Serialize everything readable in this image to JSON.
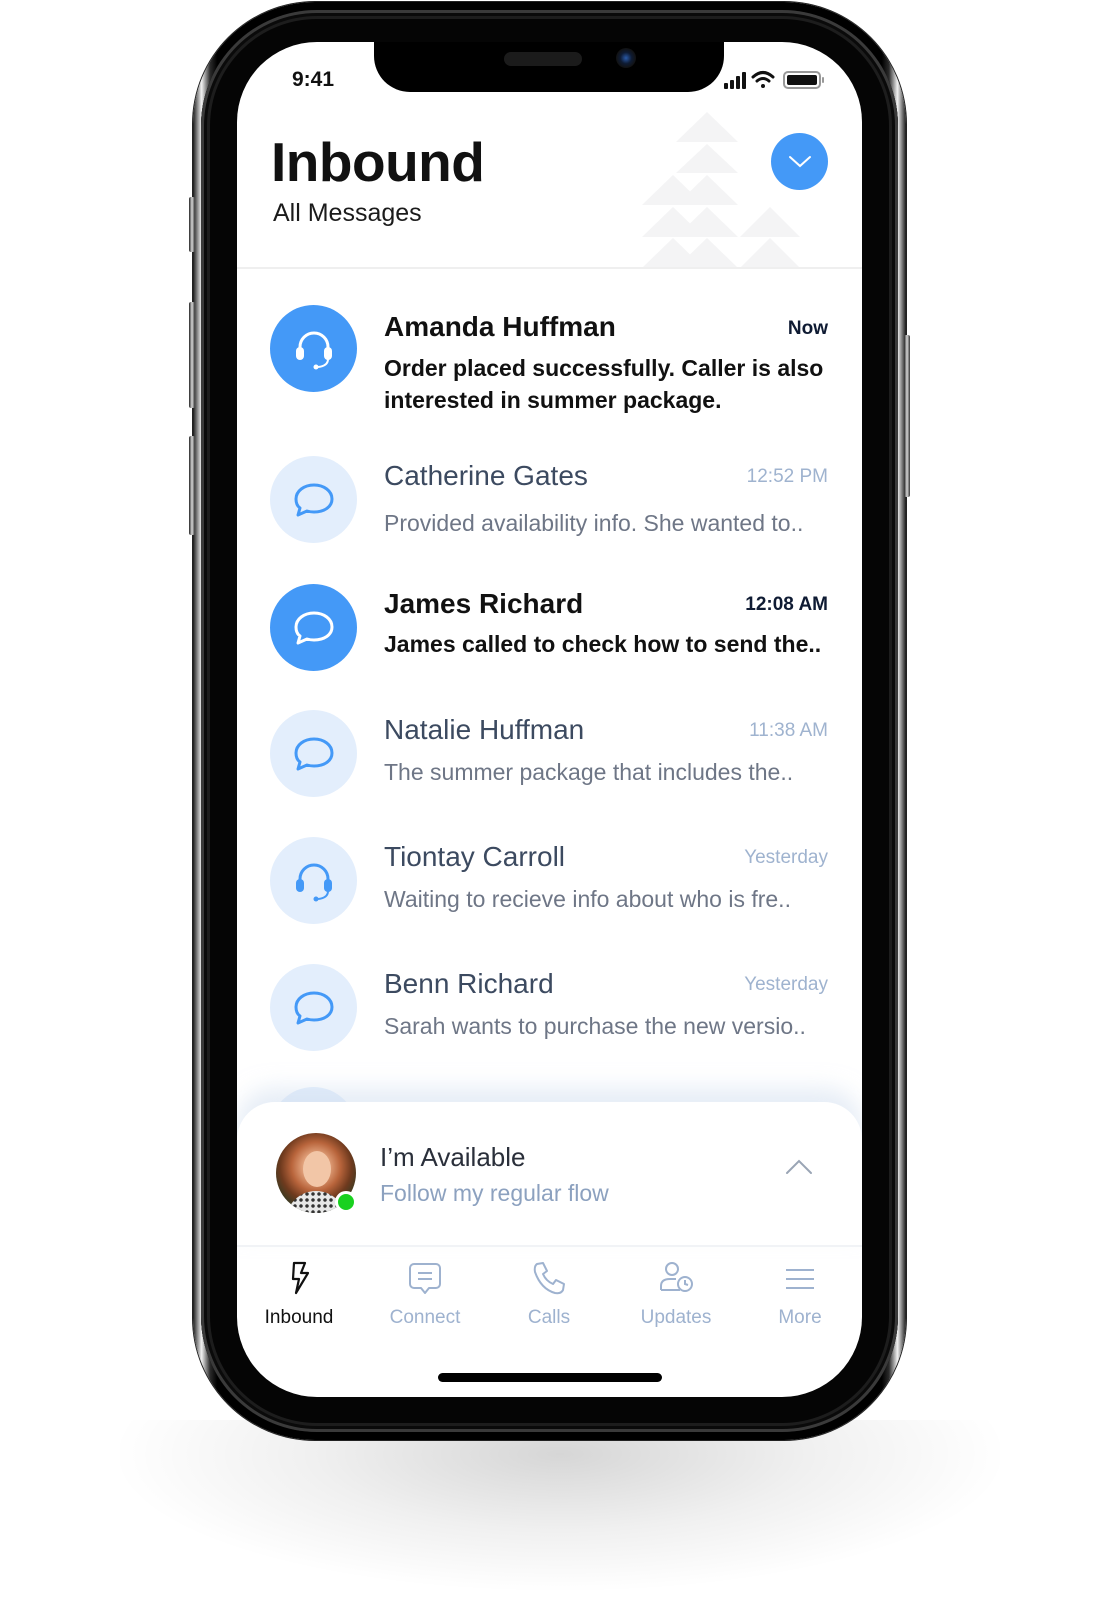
{
  "status_bar": {
    "time": "9:41",
    "icons": [
      "cellular-signal-icon",
      "wifi-icon",
      "battery-icon"
    ]
  },
  "header": {
    "title": "Inbound",
    "subtitle": "All Messages",
    "filter_button_icon": "chevron-down-icon",
    "accent_color": "#4499f7"
  },
  "messages": [
    {
      "name": "Amanda Huffman",
      "time": "Now",
      "preview": "Order placed successfully. Caller is also interested in summer package.",
      "icon": "headset-icon",
      "unread": true
    },
    {
      "name": "Catherine Gates",
      "time": "12:52 PM",
      "preview": "Provided availability info. She wanted to..",
      "icon": "chat-bubble-icon",
      "unread": false
    },
    {
      "name": "James Richard",
      "time": "12:08 AM",
      "preview": "James called to check how to send the..",
      "icon": "chat-bubble-icon",
      "unread": true
    },
    {
      "name": "Natalie Huffman",
      "time": "11:38 AM",
      "preview": "The summer package that includes the..",
      "icon": "chat-bubble-icon",
      "unread": false
    },
    {
      "name": "Tiontay Carroll",
      "time": "Yesterday",
      "preview": "Waiting to recieve info about who is fre..",
      "icon": "headset-icon",
      "unread": false
    },
    {
      "name": "Benn Richard",
      "time": "Yesterday",
      "preview": "Sarah wants to purchase the new versio..",
      "icon": "chat-bubble-icon",
      "unread": false
    }
  ],
  "availability": {
    "title": "I’m Available",
    "subtitle": "Follow my regular flow",
    "status": "online",
    "status_color": "#19d11f",
    "expand_icon": "chevron-up-icon"
  },
  "tabs": [
    {
      "label": "Inbound",
      "icon": "lightning-icon",
      "active": true
    },
    {
      "label": "Connect",
      "icon": "message-square-icon",
      "active": false
    },
    {
      "label": "Calls",
      "icon": "phone-icon",
      "active": false
    },
    {
      "label": "Updates",
      "icon": "user-clock-icon",
      "active": false
    },
    {
      "label": "More",
      "icon": "menu-icon",
      "active": false
    }
  ]
}
